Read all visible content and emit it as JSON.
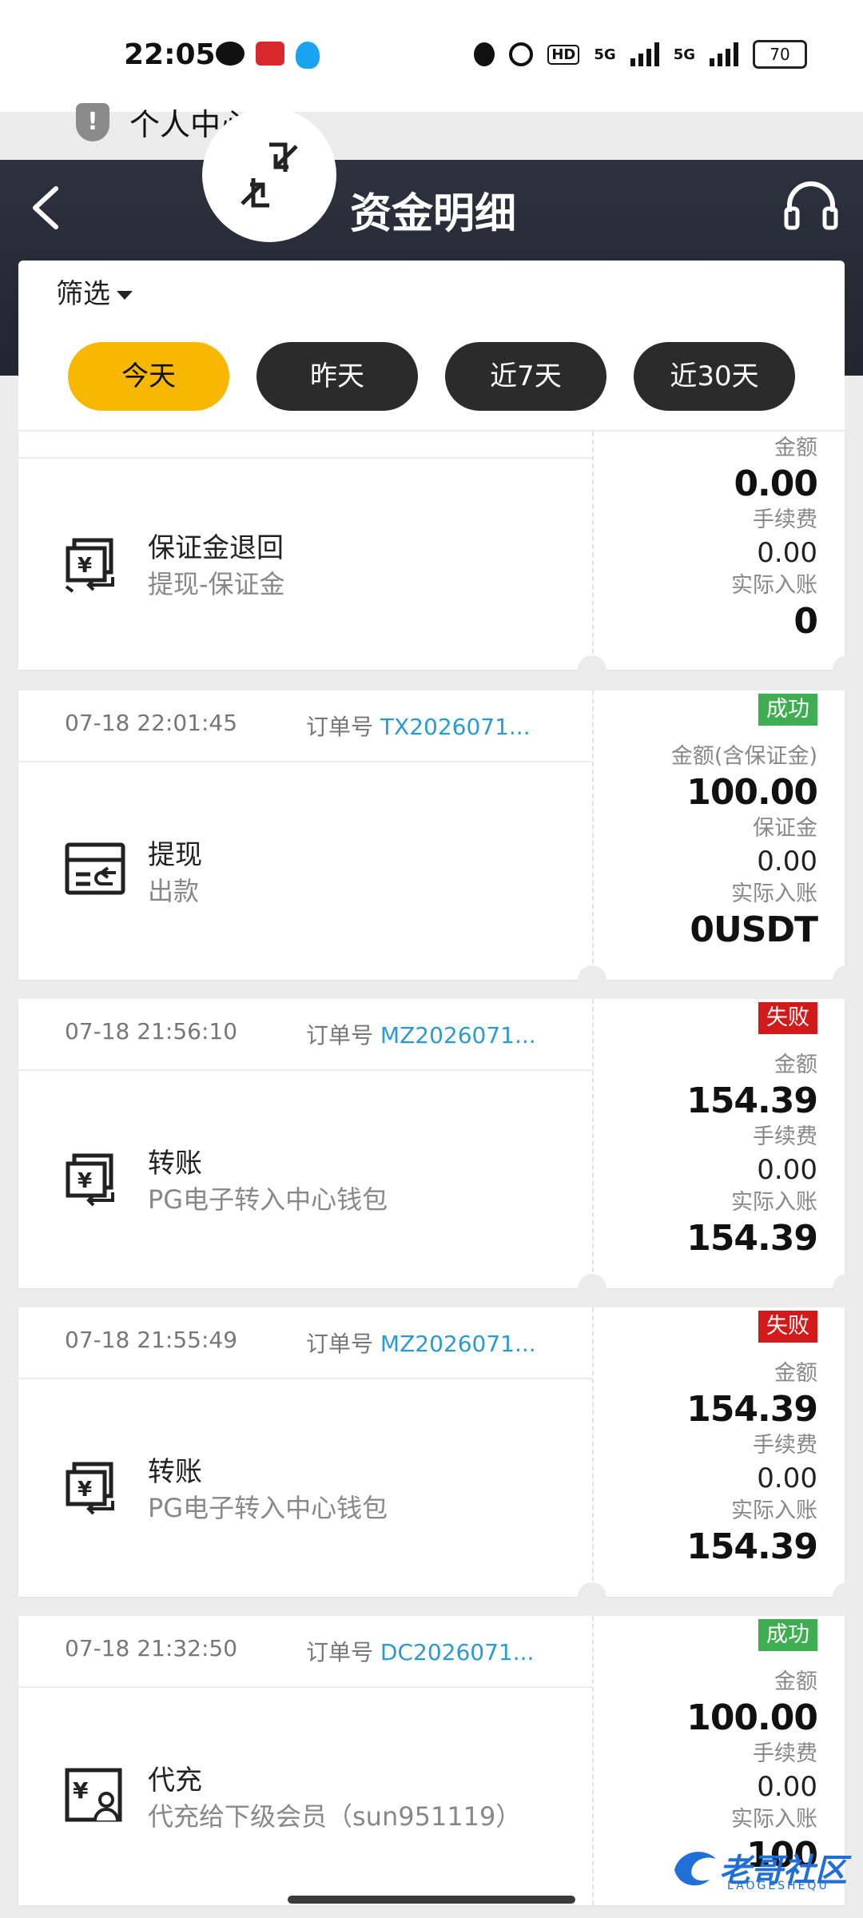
{
  "status_bar": {
    "time": "22:05",
    "battery": "70",
    "hd": "HD",
    "net1": "5G",
    "net2": "5G"
  },
  "notice": {
    "text": "个人中心"
  },
  "header": {
    "title": "资金明细"
  },
  "filter": {
    "label": "筛选",
    "chips": [
      {
        "label": "今天",
        "active": true
      },
      {
        "label": "昨天",
        "active": false
      },
      {
        "label": "近7天",
        "active": false
      },
      {
        "label": "近30天",
        "active": false
      }
    ]
  },
  "records": [
    {
      "title": "保证金退回",
      "subtitle": "提现-保证金",
      "labels": [
        "金额",
        "手续费",
        "实际入账"
      ],
      "values": [
        "0.00",
        "0.00",
        "0"
      ]
    },
    {
      "date": "07-18 22:01:45",
      "order_label": "订单号",
      "order_no": "TX2026071...",
      "status": "成功",
      "title": "提现",
      "subtitle": "出款",
      "labels": [
        "金额(含保证金)",
        "保证金",
        "实际入账"
      ],
      "values": [
        "100.00",
        "0.00",
        "0USDT"
      ]
    },
    {
      "date": "07-18 21:56:10",
      "order_label": "订单号",
      "order_no": "MZ2026071...",
      "status": "失败",
      "title": "转账",
      "subtitle": "PG电子转入中心钱包",
      "labels": [
        "金额",
        "手续费",
        "实际入账"
      ],
      "values": [
        "154.39",
        "0.00",
        "154.39"
      ]
    },
    {
      "date": "07-18 21:55:49",
      "order_label": "订单号",
      "order_no": "MZ2026071...",
      "status": "失败",
      "title": "转账",
      "subtitle": "PG电子转入中心钱包",
      "labels": [
        "金额",
        "手续费",
        "实际入账"
      ],
      "values": [
        "154.39",
        "0.00",
        "154.39"
      ]
    },
    {
      "date": "07-18 21:32:50",
      "order_label": "订单号",
      "order_no": "DC2026071...",
      "status": "成功",
      "title": "代充",
      "subtitle": "代充给下级会员（sun951119）",
      "labels": [
        "金额",
        "手续费",
        "实际入账"
      ],
      "values": [
        "100.00",
        "0.00",
        "100"
      ]
    }
  ],
  "watermark": {
    "text": "老哥社区",
    "sub": "LAOGESHEQU"
  },
  "colors": {
    "accent": "#f8b800",
    "success": "#3fae52",
    "fail": "#d31a1a",
    "link": "#2a9ad6",
    "header": "#2e323e"
  }
}
